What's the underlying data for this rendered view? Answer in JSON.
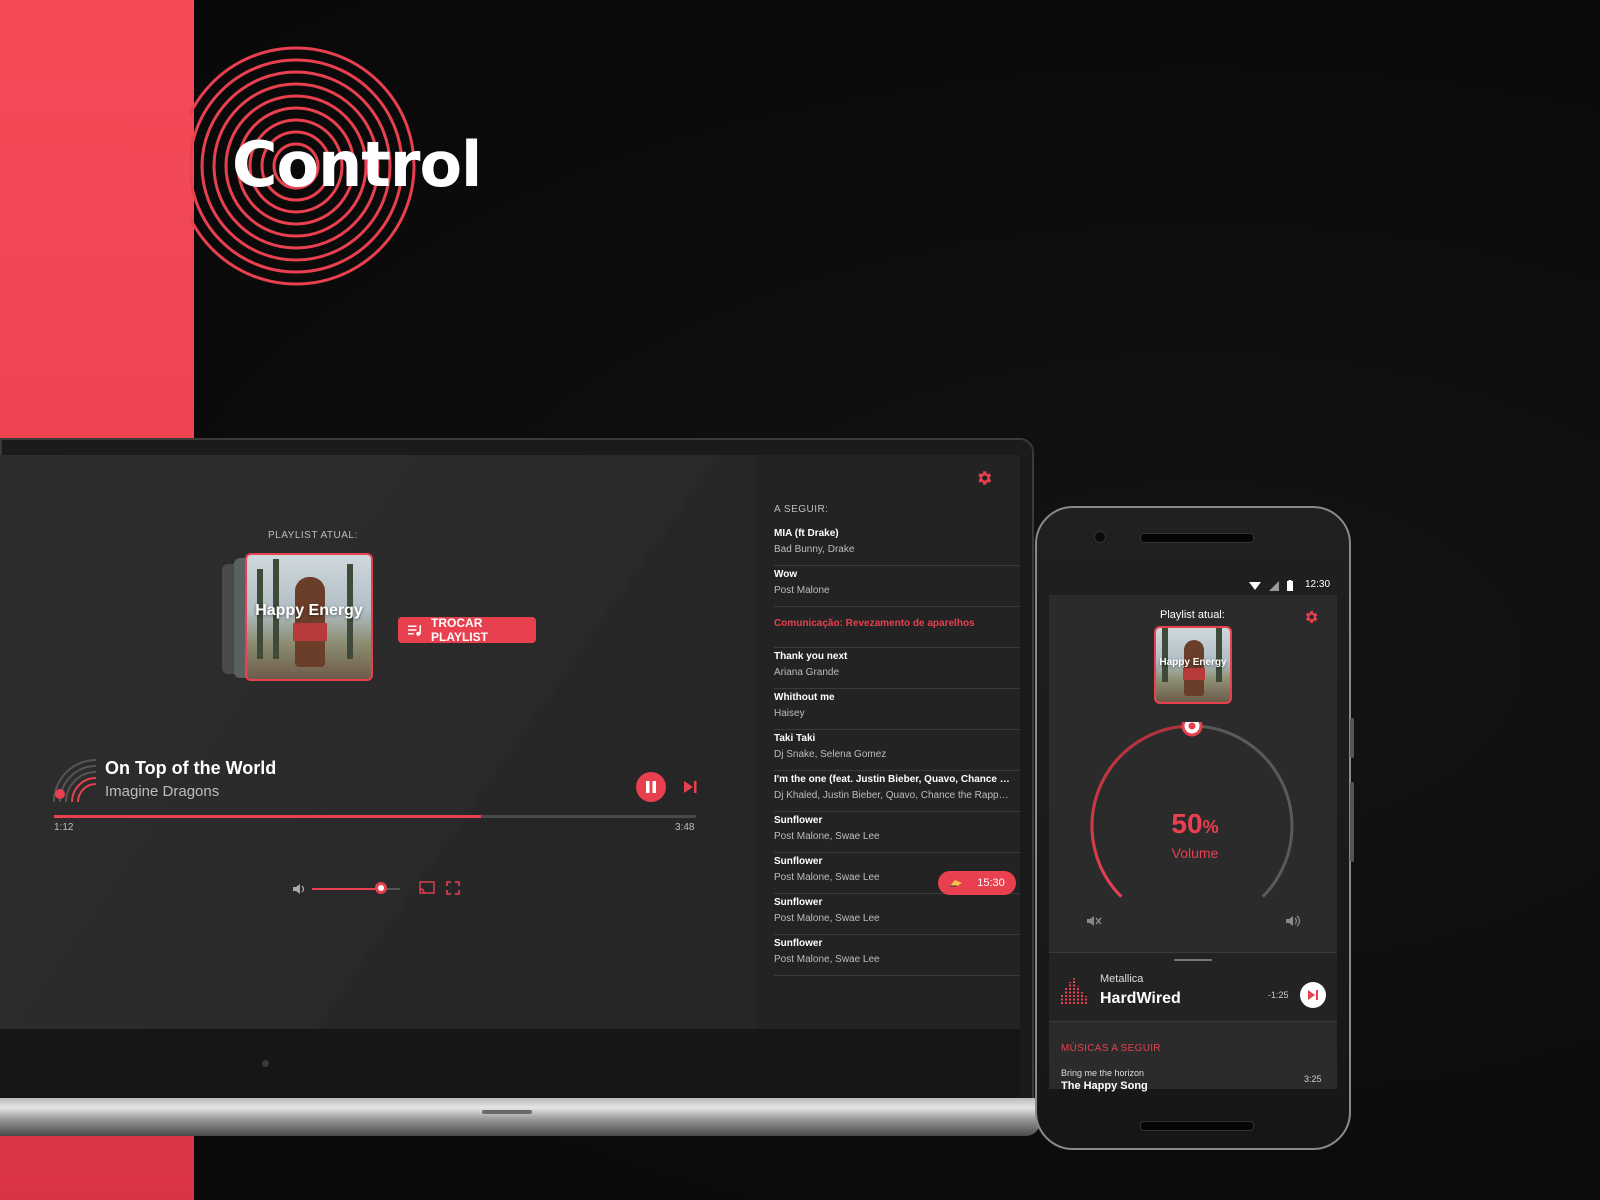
{
  "brand": {
    "name": "Control",
    "accent": "#e8404f"
  },
  "laptop": {
    "playlist_label": "PLAYLIST ATUAL:",
    "cover_text": "Happy Energy",
    "change_playlist_button": "TROCAR PLAYLIST",
    "now_playing": {
      "title": "On Top of the World",
      "artist": "Imagine Dragons",
      "elapsed": "1:12",
      "duration": "3:48",
      "progress": 0.665
    },
    "volume_level": 0.78,
    "queue_label": "A SEGUIR:",
    "queue": [
      {
        "title": "MIA (ft Drake)",
        "artist": "Bad Bunny, Drake"
      },
      {
        "title": "Wow",
        "artist": "Post Malone"
      },
      {
        "title": "Comunicação: Revezamento de aparelhos",
        "artist": "",
        "highlight": true
      },
      {
        "title": "Thank you next",
        "artist": "Ariana Grande"
      },
      {
        "title": "Whithout me",
        "artist": "Haisey"
      },
      {
        "title": "Taki Taki",
        "artist": "Dj Snake, Selena Gomez"
      },
      {
        "title": "I'm the one (feat. Justin Bieber, Quavo, Chance the Rapper, Lil Wayne)",
        "artist": "Dj Khaled, Justin Bieber, Quavo, Chance the Rapper, Lil Wayne"
      },
      {
        "title": "Sunflower",
        "artist": "Post Malone, Swae Lee"
      },
      {
        "title": "Sunflower",
        "artist": "Post Malone, Swae Lee"
      },
      {
        "title": "Sunflower",
        "artist": "Post Malone, Swae Lee"
      },
      {
        "title": "Sunflower",
        "artist": "Post Malone, Swae Lee"
      }
    ],
    "timer": "15:30"
  },
  "phone": {
    "status_time": "12:30",
    "playlist_label": "Playlist atual:",
    "cover_text": "Happy Energy",
    "volume": {
      "value": "50",
      "unit": "%",
      "label": "Volume",
      "level": 0.5
    },
    "mini_player": {
      "artist": "Metallica",
      "title": "HardWired",
      "remaining": "-1:25"
    },
    "next_label": "MÚSICAS A SEGUIR",
    "next_item": {
      "artist": "Bring me the horizon",
      "title": "The Happy Song",
      "duration": "3:25"
    }
  }
}
